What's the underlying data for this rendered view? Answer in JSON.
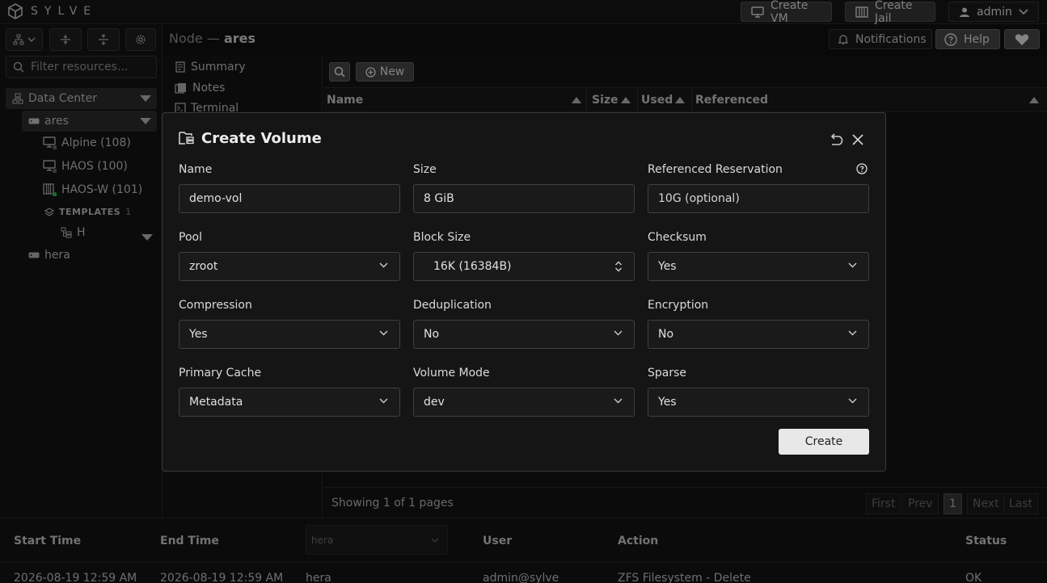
{
  "app": {
    "logo_text": "SYLVE"
  },
  "topbar": {
    "create_vm": "Create VM",
    "create_jail": "Create Jail",
    "user": "admin"
  },
  "sidebar": {
    "filter_placeholder": "Filter resources...",
    "datacenter": "Data Center",
    "node_ares": "ares",
    "vm_alpine": "Alpine (108)",
    "vm_haos": "HAOS (100)",
    "vm_haos_w": "HAOS-W (101)",
    "templates_label": "TEMPLATES",
    "templates_count": "1",
    "template_h": "H",
    "node_hera": "hera"
  },
  "header": {
    "node_prefix": "Node —",
    "node_name": "ares",
    "notifications": "Notifications",
    "help": "Help"
  },
  "node_menu": {
    "summary": "Summary",
    "notes": "Notes",
    "terminal": "Terminal"
  },
  "toolbar": {
    "new_label": "New"
  },
  "table": {
    "columns": [
      "Name",
      "Size",
      "Used",
      "Referenced"
    ]
  },
  "pager": {
    "showing": "Showing 1 of 1 pages",
    "first": "First",
    "prev": "Prev",
    "page": "1",
    "next": "Next",
    "last": "Last"
  },
  "log": {
    "columns": {
      "start": "Start Time",
      "end": "End Time",
      "node_filter": "hera",
      "user": "User",
      "action": "Action",
      "status": "Status"
    },
    "row": {
      "start": "2026-08-19 12:59 AM",
      "end": "2026-08-19 12:59 AM",
      "node": "hera",
      "user": "admin@sylve",
      "action": "ZFS Filesystem - Delete",
      "status": "OK"
    }
  },
  "modal": {
    "title": "Create Volume",
    "fields": {
      "name": {
        "label": "Name",
        "value": "demo-vol"
      },
      "size": {
        "label": "Size",
        "value": "8 GiB"
      },
      "refres": {
        "label": "Referenced Reservation",
        "placeholder": "10G (optional)"
      },
      "pool": {
        "label": "Pool",
        "value": "zroot"
      },
      "blocksize": {
        "label": "Block Size",
        "value": "16K (16384B)"
      },
      "checksum": {
        "label": "Checksum",
        "value": "Yes"
      },
      "compression": {
        "label": "Compression",
        "value": "Yes"
      },
      "dedup": {
        "label": "Deduplication",
        "value": "No"
      },
      "encryption": {
        "label": "Encryption",
        "value": "No"
      },
      "primarycache": {
        "label": "Primary Cache",
        "value": "Metadata"
      },
      "volmode": {
        "label": "Volume Mode",
        "value": "dev"
      },
      "sparse": {
        "label": "Sparse",
        "value": "Yes"
      }
    },
    "create_label": "Create"
  },
  "colors": {
    "background": "#111111",
    "panel": "#151515",
    "online": "#22c55e",
    "offline": "#6b6b6b",
    "primary_button": "#e8e8e8"
  }
}
